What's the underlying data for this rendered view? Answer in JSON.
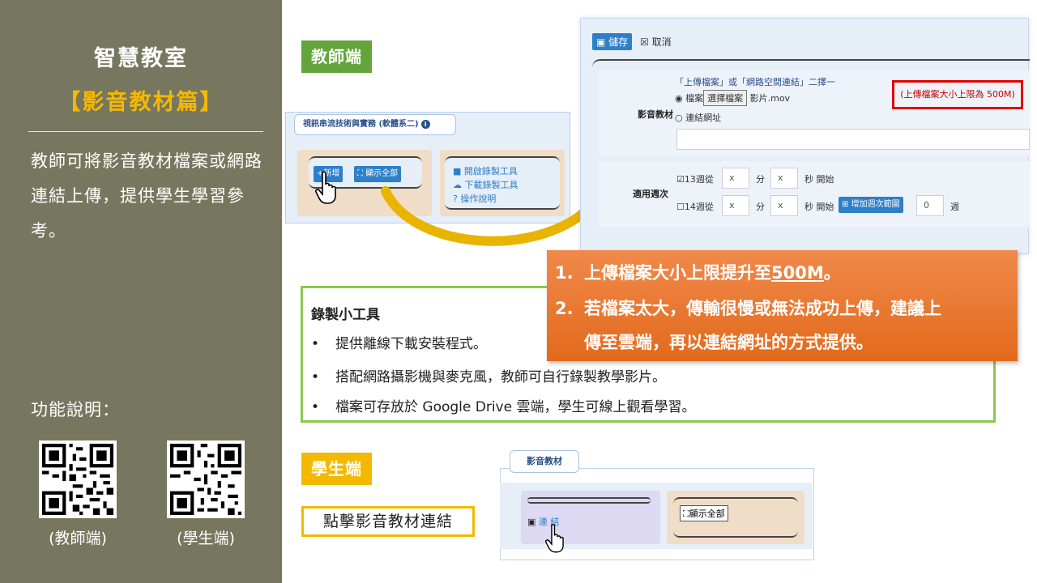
{
  "sidebar": {
    "title": "智慧教室",
    "subtitle": "【影音教材篇】",
    "description": "教師可將影音教材檔案或網路連結上傳，提供學生學習參考。",
    "function_label": "功能說明：",
    "qr_teacher_label": "(教師端)",
    "qr_student_label": "(學生端)"
  },
  "teacher": {
    "tag": "教師端",
    "widget": {
      "header": "視訊串流技術與實務 (軟體系二)",
      "add_button": "+新增",
      "show_all_button": "顯示全部",
      "links": [
        "開啟錄製工具",
        "下載錄製工具",
        "操作說明"
      ]
    },
    "form": {
      "save": "儲存",
      "cancel": "取消",
      "media_label": "影音教材",
      "choice_hint": "「上傳檔案」或「網路空間連結」二擇一",
      "file_option": "檔案",
      "choose_file": "選擇檔案",
      "file_name": "影片.mov",
      "link_option": "連結網址",
      "size_note": "(上傳檔案大小上限為 500M)",
      "week_label": "適用週次",
      "week13": "13週從",
      "week14": "14週從",
      "x": "x",
      "min": "分",
      "sec_start": "秒 開始",
      "add_range": "增加週次範圍",
      "range_value": "0",
      "week_unit": "週"
    }
  },
  "callout": {
    "line1_num": "1.",
    "line1_text": "上傳檔案大小上限提升至",
    "line1_highlight": "500M",
    "line1_end": "。",
    "line2_num": "2.",
    "line2_text": "若檔案太大，傳輸很慢或無法成功上傳，建議上",
    "line3_text": "傳至雲端，再以連結網址的方式提供。"
  },
  "tool": {
    "title": "錄製小工具",
    "items": [
      "提供離線下載安裝程式。",
      "搭配網路攝影機與麥克風，教師可自行錄製教學影片。",
      "檔案可存放於 Google Drive 雲端，學生可線上觀看學習。"
    ]
  },
  "student": {
    "tag": "學生端",
    "note": "點擊影音教材連結",
    "widget_header": "影音教材",
    "link": "連 結",
    "show_all": "顯示全部"
  },
  "colors": {
    "sidebar_bg": "#77775f",
    "accent_gold": "#f5b800",
    "teacher_green": "#63a53a",
    "callout_orange": "#e26a1c",
    "button_blue": "#2d7fc8"
  }
}
